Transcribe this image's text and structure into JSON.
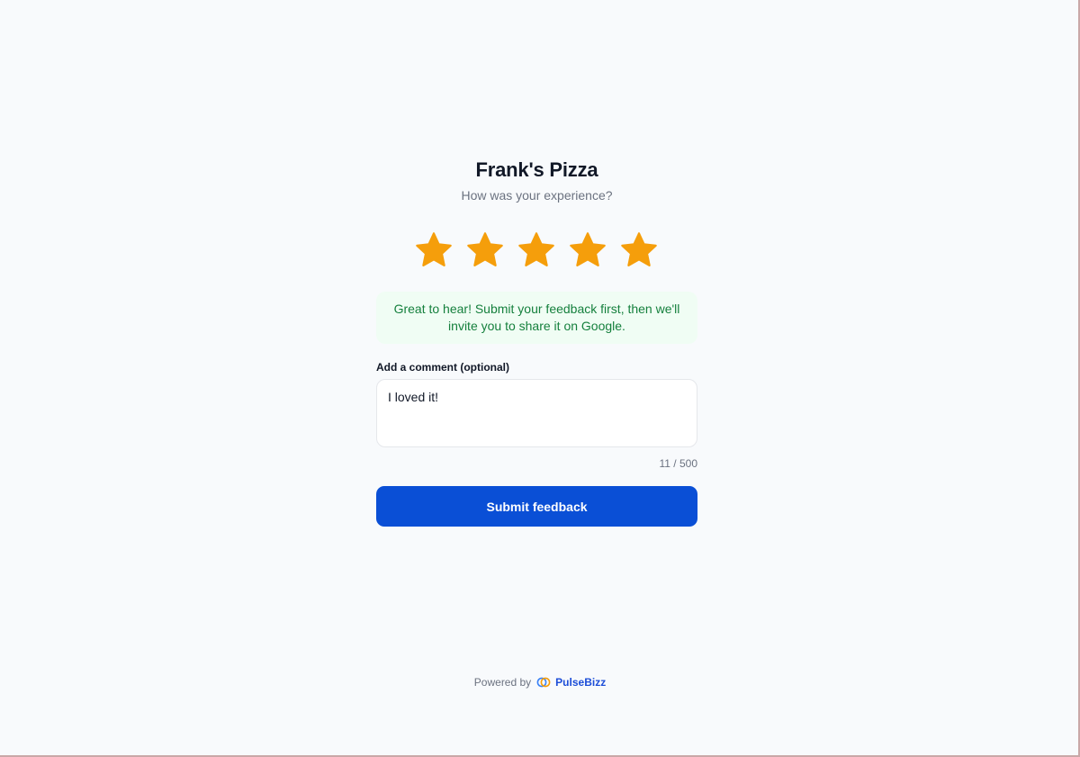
{
  "business": {
    "name": "Frank's Pizza",
    "prompt": "How was your experience?"
  },
  "rating": {
    "value": 5,
    "max": 5,
    "star_color": "#f59e0b",
    "star_icons": [
      "star-icon",
      "star-icon",
      "star-icon",
      "star-icon",
      "star-icon"
    ]
  },
  "notice": {
    "text": "Great to hear! Submit your feedback first, then we'll invite you to share it on Google.",
    "text_color": "#15803d",
    "background": "#f0fdf4"
  },
  "comment": {
    "label": "Add a comment (optional)",
    "value": "I loved it!",
    "counter": "11 / 500"
  },
  "submit": {
    "label": "Submit feedback",
    "color": "#0a4fd6"
  },
  "footer": {
    "powered_by": "Powered by",
    "brand_icon": "pulsebizz-logo-icon",
    "brand": "PulseBizz"
  }
}
